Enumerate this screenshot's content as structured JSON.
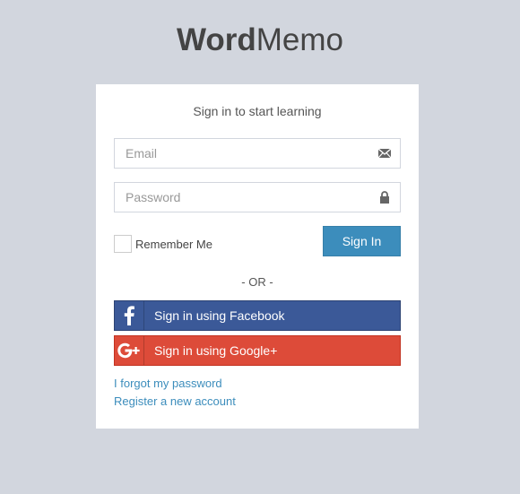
{
  "logo": {
    "bold": "Word",
    "light": "Memo"
  },
  "login": {
    "message": "Sign in to start learning",
    "email_placeholder": "Email",
    "password_placeholder": "Password",
    "remember_label": "Remember Me",
    "remember_checked": false,
    "signin_label": "Sign In",
    "or_label": "- OR -",
    "facebook_label": "Sign in using Facebook",
    "google_label": "Sign in using Google+",
    "forgot_label": "I forgot my password",
    "register_label": "Register a new account"
  },
  "icons": {
    "email": "envelope-icon",
    "password": "lock-icon",
    "facebook": "facebook-icon",
    "google": "google-plus-icon"
  },
  "colors": {
    "background": "#d2d6de",
    "primary": "#3c8dbc",
    "facebook": "#3b5998",
    "google": "#dd4b39",
    "link": "#3c8dbc"
  }
}
